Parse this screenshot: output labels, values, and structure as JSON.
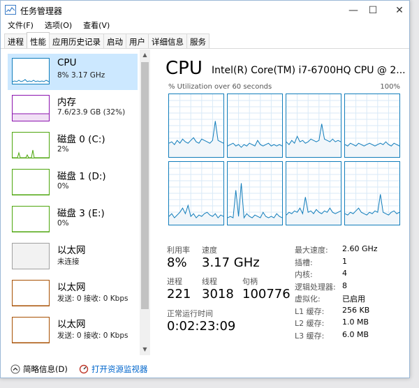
{
  "window": {
    "title": "任务管理器",
    "minimize": "—",
    "maximize": "☐",
    "close": "✕"
  },
  "menu": [
    "文件(F)",
    "选项(O)",
    "查看(V)"
  ],
  "tabs": [
    {
      "label": "进程",
      "active": false
    },
    {
      "label": "性能",
      "active": true
    },
    {
      "label": "应用历史记录",
      "active": false
    },
    {
      "label": "启动",
      "active": false
    },
    {
      "label": "用户",
      "active": false
    },
    {
      "label": "详细信息",
      "active": false
    },
    {
      "label": "服务",
      "active": false
    }
  ],
  "sidebar": {
    "items": [
      {
        "name": "CPU",
        "value": "8% 3.17 GHz",
        "color": "#117dbb",
        "selected": true
      },
      {
        "name": "内存",
        "value": "7.6/23.9 GB (32%)",
        "color": "#8b12ae",
        "selected": false
      },
      {
        "name": "磁盘 0 (C:)",
        "value": "2%",
        "color": "#4da60c",
        "selected": false
      },
      {
        "name": "磁盘 1 (D:)",
        "value": "0%",
        "color": "#4da60c",
        "selected": false
      },
      {
        "name": "磁盘 3 (E:)",
        "value": "0%",
        "color": "#4da60c",
        "selected": false
      },
      {
        "name": "以太网",
        "value": "未连接",
        "color": "#a0a0a0",
        "selected": false
      },
      {
        "name": "以太网",
        "value": "发送: 0 接收: 0 Kbps",
        "color": "#a74f01",
        "selected": false
      },
      {
        "name": "以太网",
        "value": "发送: 0 接收: 0 Kbps",
        "color": "#a74f01",
        "selected": false
      }
    ]
  },
  "main": {
    "title": "CPU",
    "model": "Intel(R) Core(TM) i7-6700HQ CPU @ 2...",
    "util_label": "% Utilization over 60 seconds",
    "util_max": "100%",
    "graph_color": "#117dbb",
    "stats": {
      "utilization_label": "利用率",
      "utilization": "8%",
      "speed_label": "速度",
      "speed": "3.17 GHz",
      "processes_label": "进程",
      "processes": "221",
      "threads_label": "线程",
      "threads": "3018",
      "handles_label": "句柄",
      "handles": "100776",
      "uptime_label": "正常运行时间",
      "uptime": "0:02:23:09"
    },
    "right_stats": [
      {
        "key": "最大速度:",
        "value": "2.60 GHz"
      },
      {
        "key": "插槽:",
        "value": "1"
      },
      {
        "key": "内核:",
        "value": "4"
      },
      {
        "key": "逻辑处理器:",
        "value": "8"
      },
      {
        "key": "虚拟化:",
        "value": "已启用"
      },
      {
        "key": "L1 缓存:",
        "value": "256 KB"
      },
      {
        "key": "L2 缓存:",
        "value": "1.0 MB"
      },
      {
        "key": "L3 缓存:",
        "value": "6.0 MB"
      }
    ]
  },
  "footer": {
    "fewer_details": "简略信息(D)",
    "open_monitor": "打开资源监视器"
  }
}
